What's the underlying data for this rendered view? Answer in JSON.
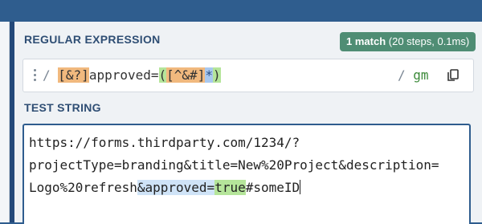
{
  "regex_section": {
    "label": "REGULAR EXPRESSION"
  },
  "match_info": {
    "count": "1 match",
    "detail": "(20 steps, 0.1ms)"
  },
  "regex": {
    "open_delim": "/",
    "set": "[&?]",
    "literal": "approved=",
    "group_open": "(",
    "neg_class": "[^&#]",
    "quantifier": "*",
    "group_close": ")",
    "close_delim": "/",
    "flags": "gm"
  },
  "test_section": {
    "label": "TEST STRING"
  },
  "test_string": {
    "line1": "https://forms.thirdparty.com/1234/?",
    "line2": "projectType=branding&title=New%20Project&description=",
    "line3_pre": "Logo%20refresh",
    "line3_match": "&approved=",
    "line3_group": "true",
    "line3_post": "#someID"
  },
  "icons": {
    "drag": "drag-handle-icon",
    "copy": "copy-icon"
  },
  "colors": {
    "header": "#2f5d8e",
    "badge": "#4f8d74",
    "match_highlight": "#cfe3f7",
    "group_highlight": "#b5e59a",
    "set_highlight": "#f1b97e"
  }
}
